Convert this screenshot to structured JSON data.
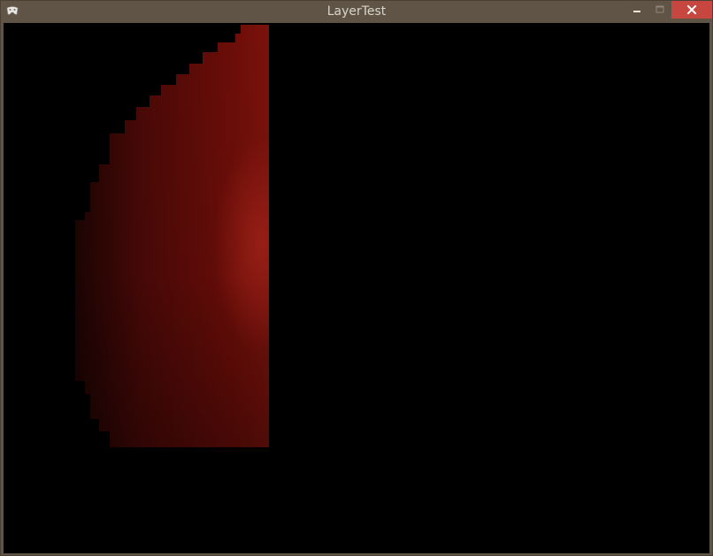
{
  "window": {
    "title": "LayerTest",
    "title_color": "#d8d4cc",
    "frame_color": "#5f5446",
    "close_color": "#c7463f"
  },
  "icons": {
    "app": "app-gamepad-icon",
    "minimize": "minimize-icon",
    "maximize": "maximize-icon",
    "close": "close-icon"
  },
  "canvas": {
    "background": "#000000",
    "shape_color_dark": "#2a0604",
    "shape_color_mid": "#6b0d08",
    "shape_color_bright": "#8c1a12"
  }
}
